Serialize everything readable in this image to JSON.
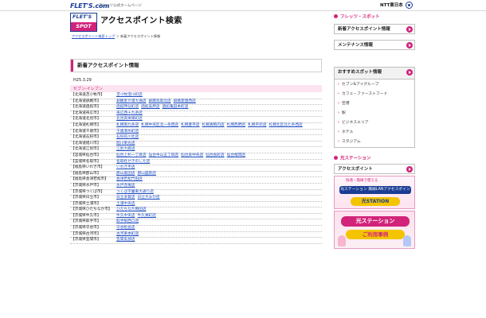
{
  "header": {
    "brand": "FLET'S.com",
    "brand_sub": "フレッツ公式ホームページ",
    "company": "NTT東日本"
  },
  "logo": {
    "line1": "FLET'S",
    "line2": "SPOT"
  },
  "page_title": "アクセスポイント検索",
  "breadcrumb": {
    "link": "アクセスポイント検索トップ",
    "sep": " ＞ ",
    "current": "新着アクセスポイント情報"
  },
  "section_title": "新着アクセスポイント情報",
  "date": "H25.3.29",
  "store_company": "セブン-イレブン",
  "rows": [
    {
      "pref": "【北海道苫小牧市】",
      "stores": [
        "苫小牧澄川町店"
      ]
    },
    {
      "pref": "【北海道釧路市】",
      "stores": [
        "釧路星が浦大通店",
        "釧路鳥取北店",
        "釧路愛国西店"
      ]
    },
    {
      "pref": "【北海道函館市】",
      "stores": [
        "函館時任町店",
        "函館美原店",
        "函館亀田本町店"
      ]
    },
    {
      "pref": "【北海道帯広市】",
      "stores": [
        "帯広西十九条店"
      ]
    },
    {
      "pref": "【北海道北見市】",
      "stores": [
        "北見高栄東町店"
      ]
    },
    {
      "pref": "【北海道札幌市】",
      "stores": [
        "札幌南九条店",
        "札幌中央区北一条西店",
        "札幌豊平店",
        "札幌真駒内店",
        "札幌西野店",
        "札幌平岸店",
        "札幌北区北七条西店"
      ]
    },
    {
      "pref": "【北海道千歳市】",
      "stores": [
        "千歳清水町店"
      ]
    },
    {
      "pref": "【北海道石狩市】",
      "stores": [
        "石狩花川北店"
      ]
    },
    {
      "pref": "【北海道旭川市】",
      "stores": [
        "旭川東光店"
      ]
    },
    {
      "pref": "【北海道江別市】",
      "stores": [
        "江別大麻店"
      ]
    },
    {
      "pref": "【宮城県仙台市】",
      "stores": [
        "仙台上杉一丁目店",
        "仙台中山五丁目店",
        "仙台泉中央店",
        "仙台長町店",
        "仙台榴岡店"
      ]
    },
    {
      "pref": "【宮城県名取市】",
      "stores": [
        "名取杜せきのした店"
      ]
    },
    {
      "pref": "【福島県いわき市】",
      "stores": [
        "いわき平店"
      ]
    },
    {
      "pref": "【福島県郡山市】",
      "stores": [
        "郡山富田店",
        "郡山図景店"
      ]
    },
    {
      "pref": "【福島県会津若松市】",
      "stores": [
        "会津若松門田店"
      ]
    },
    {
      "pref": "【茨城県水戸市】",
      "stores": [
        "水戸赤塚店"
      ]
    },
    {
      "pref": "【茨城県つくば市】",
      "stores": [
        "つくば学園東大通り店"
      ]
    },
    {
      "pref": "【茨城県日立市】",
      "stores": [
        "日立多賀店",
        "日立大みか店"
      ]
    },
    {
      "pref": "【茨城県土浦市】",
      "stores": [
        "土浦中央店"
      ]
    },
    {
      "pref": "【茨城県ひたちなか市】",
      "stores": [
        "ひたちなか勝田店"
      ]
    },
    {
      "pref": "【茨城県牛久市】",
      "stores": [
        "牛久中央店",
        "牛久栄町店"
      ]
    },
    {
      "pref": "【茨城県取手市】",
      "stores": [
        "取手駅西口店"
      ]
    },
    {
      "pref": "【茨城県守谷市】",
      "stores": [
        "守谷松並店"
      ]
    },
    {
      "pref": "【茨城県古河市】",
      "stores": [
        "古河東本町店"
      ]
    },
    {
      "pref": "【茨城県笠間市】",
      "stores": [
        "笠間友部店"
      ]
    }
  ],
  "sidebar": {
    "head1": "フレッツ・スポット",
    "menu1": "新着アクセスポイント情報",
    "menu2": "メンテナンス情報",
    "menu3": "おすすめスポット情報",
    "subs": [
      "セブン&アイグループ",
      "カフェ・ファーストフード",
      "空港",
      "駅",
      "ビジネスエリア",
      "ホテル",
      "スタジアム"
    ],
    "head2": "光ステーション",
    "menu4": "アクセスポイント",
    "banner1_line1": "快適・無線で使える",
    "banner1_line2": "光ステーション 無線LANアクセスポイント",
    "banner1_line3": "光STATION",
    "banner2_title": "光ステーション",
    "banner2_sub": "ご利用事例"
  }
}
